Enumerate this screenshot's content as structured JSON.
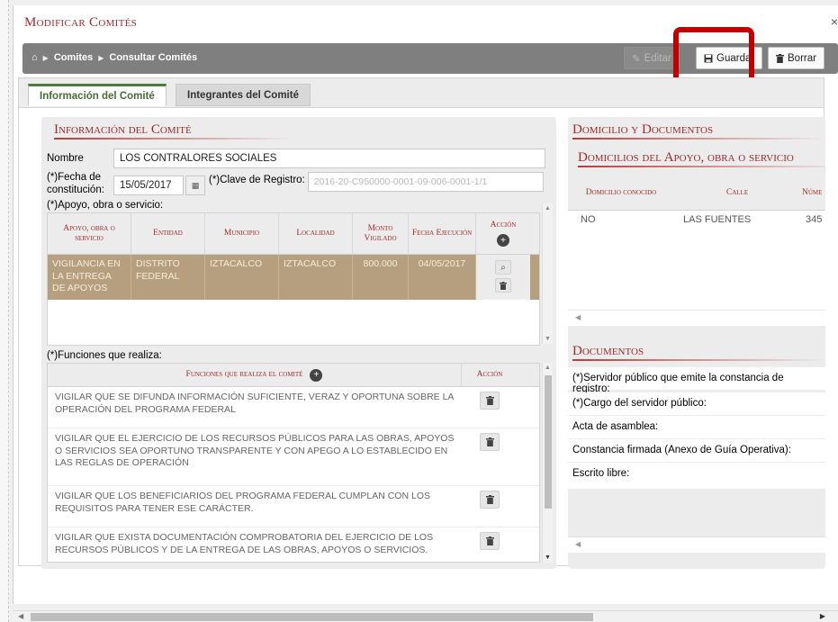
{
  "dialog": {
    "title": "Modificar Comités",
    "close_glyph": "×"
  },
  "toolbar": {
    "home_glyph": "⌂",
    "breadcrumb": [
      "Comites",
      "Consultar Comités"
    ],
    "edit_label": "Editar",
    "save_label": "Guardar",
    "delete_label": "Borrar"
  },
  "tabs": [
    {
      "label": "Información del Comité",
      "active": true
    },
    {
      "label": "Integrantes del Comité",
      "active": false
    }
  ],
  "info": {
    "section_title": "Información del Comité",
    "nombre_label": "Nombre",
    "nombre_value": "LOS CONTRALORES SOCIALES",
    "fecha_label_1": "(*)Fecha de",
    "fecha_label_2": "constitución:",
    "fecha_value": "15/05/2017",
    "clave_label": "(*)Clave de Registro:",
    "clave_value": "2016-20-C950000-0001-09-006-0001-1/1",
    "apoyo_label": "(*)Apoyo, obra o servicio:"
  },
  "apoyo_table": {
    "headers": [
      "Apoyo, obra o servicio",
      "Entidad",
      "Municipio",
      "Localidad",
      "Monto Vigilado",
      "Fecha Ejecución",
      "Acción"
    ],
    "rows": [
      [
        "VIGILANCIA EN LA ENTREGA DE APOYOS",
        "DISTRITO FEDERAL",
        "IZTACALCO",
        "IZTACALCO",
        "800.000",
        "04/05/2017"
      ]
    ]
  },
  "funciones": {
    "label": "(*)Funciones que realiza:",
    "header_main": "Funciones que realiza el comité",
    "header_action": "Acción",
    "items": [
      "VIGILAR QUE SE DIFUNDA INFORMACIÓN SUFICIENTE, VERAZ Y OPORTUNA SOBRE LA OPERACIÓN DEL PROGRAMA FEDERAL",
      "VIGILAR QUE EL EJERCICIO DE LOS RECURSOS PÚBLICOS PARA LAS OBRAS, APOYOS O SERVICIOS SEA OPORTUNO TRANSPARENTE Y CON APEGO A LO ESTABLECIDO EN LAS REGLAS DE OPERACIÓN",
      "VIGILAR QUE LOS BENEFICIARIOS DEL PROGRAMA FEDERAL CUMPLAN CON LOS REQUISITOS PARA TENER ESE CARÁCTER.",
      "VIGILAR QUE EXISTA DOCUMENTACIÓN COMPROBATORIA DEL EJERCICIO DE LOS RECURSOS PÚBLICOS Y DE LA ENTREGA DE LAS OBRAS, APOYOS O SERVICIOS."
    ]
  },
  "domicilio": {
    "section_title": "Domicilio y Documentos",
    "sub_title": "Domicilios del Apoyo, obra o servicio",
    "headers": [
      "Domicilio conocido",
      "Calle",
      "Núme"
    ],
    "row": [
      "NO",
      "LAS FUENTES",
      "345"
    ]
  },
  "documentos": {
    "section_title": "Documentos",
    "items": [
      "(*)Servidor público que emite la constancia de registro:",
      "(*)Cargo del servidor público:",
      "Acta de asamblea:",
      "Constancia firmada (Anexo de Guía Operativa):",
      "Escrito libre:"
    ]
  }
}
